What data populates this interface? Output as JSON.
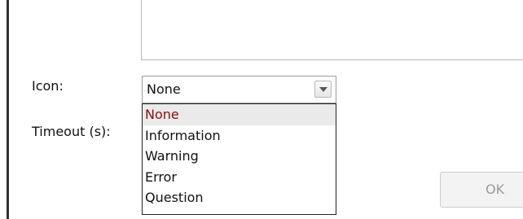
{
  "form": {
    "icon_label": "Icon:",
    "timeout_label": "Timeout (s):"
  },
  "icon_select": {
    "value": "None",
    "options": [
      "None",
      "Information",
      "Warning",
      "Error",
      "Question"
    ],
    "highlighted_index": 0
  },
  "buttons": {
    "ok": "OK"
  },
  "icons": {
    "dropdown_arrow": "chevron-down-icon"
  },
  "colors": {
    "highlight_text": "#8b1010",
    "highlight_bg": "#eaeaea"
  }
}
